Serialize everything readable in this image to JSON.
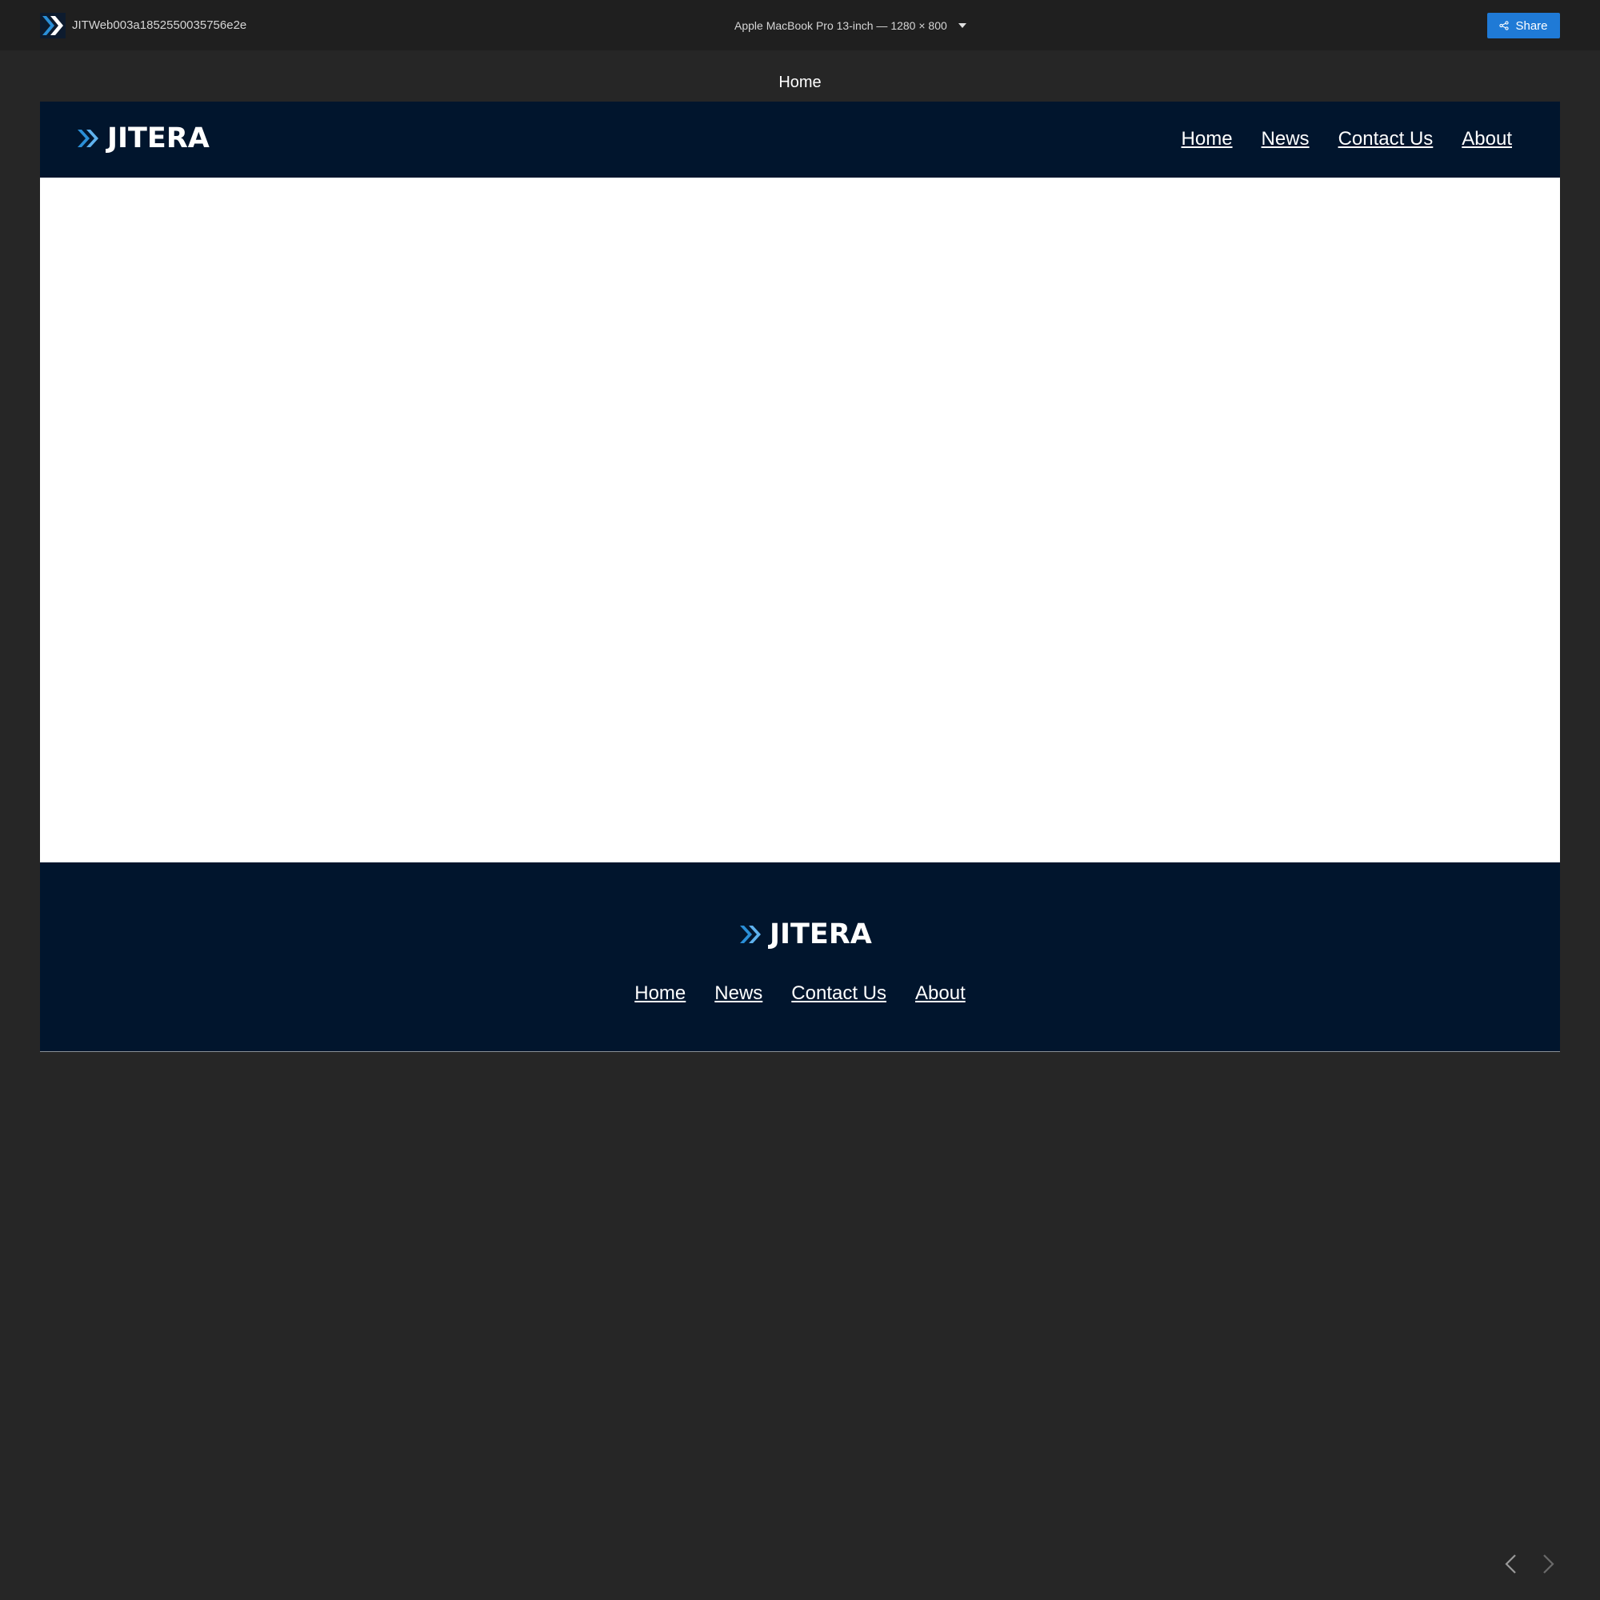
{
  "topbar": {
    "project_name": "JITWeb003a1852550035756e2e",
    "device": "Apple MacBook Pro 13-inch — 1280 × 800",
    "share_label": "Share"
  },
  "page_name": "Home",
  "site": {
    "brand": "JITERA",
    "nav": [
      "Home",
      "News",
      "Contact Us",
      "About"
    ]
  },
  "colors": {
    "topbar_bg": "#1f1f1f",
    "canvas_bg": "#262626",
    "site_navy": "#01152d",
    "accent_blue": "#1f7ad6"
  }
}
